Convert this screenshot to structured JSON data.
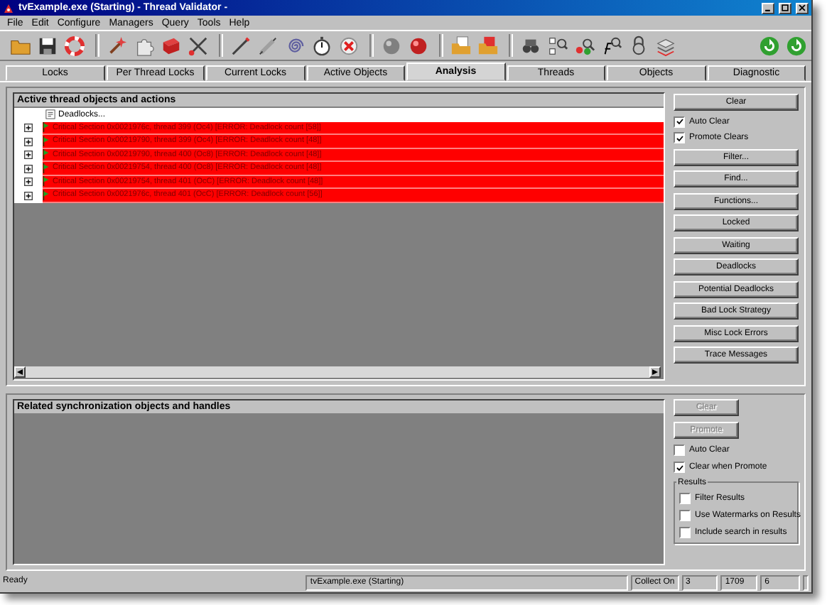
{
  "window": {
    "title": "tvExample.exe (Starting) - Thread Validator -"
  },
  "menu": [
    "File",
    "Edit",
    "Configure",
    "Managers",
    "Query",
    "Tools",
    "Help"
  ],
  "tabs": [
    {
      "label": "Locks",
      "selected": false
    },
    {
      "label": "Per Thread Locks",
      "selected": false
    },
    {
      "label": "Current Locks",
      "selected": false
    },
    {
      "label": "Active Objects",
      "selected": false
    },
    {
      "label": "Analysis",
      "selected": true
    },
    {
      "label": "Threads",
      "selected": false
    },
    {
      "label": "Objects",
      "selected": false
    },
    {
      "label": "Diagnostic",
      "selected": false
    }
  ],
  "upper_panel": {
    "title": "Active thread objects and actions",
    "tree": [
      {
        "kind": "header",
        "label": "Deadlocks..."
      },
      {
        "kind": "error",
        "expanded": false,
        "label": "Critical Section 0x0021976c, thread 399 (Oc4) [ERROR: Deadlock count [58]]"
      },
      {
        "kind": "error",
        "expanded": false,
        "label": "Critical Section 0x00219790, thread 399 (Oc4) [ERROR: Deadlock count [48]]"
      },
      {
        "kind": "error",
        "expanded": false,
        "label": "Critical Section 0x00219790, thread 400 (Oc8) [ERROR: Deadlock count [48]]"
      },
      {
        "kind": "error",
        "expanded": false,
        "label": "Critical Section 0x00219754, thread 400 (Oc8) [ERROR: Deadlock count [48]]"
      },
      {
        "kind": "error",
        "expanded": false,
        "label": "Critical Section 0x00219754, thread 401 (OcC) [ERROR: Deadlock count [48]]"
      },
      {
        "kind": "error",
        "expanded": false,
        "label": "Critical Section 0x0021976c, thread 401 (OcC) [ERROR: Deadlock count [56]]"
      }
    ],
    "controls": [
      {
        "kind": "button",
        "label": "Clear"
      },
      {
        "kind": "checkbox",
        "label": "Auto Clear",
        "checked": true
      },
      {
        "kind": "checkbox",
        "label": "Promote Clears",
        "checked": true
      },
      {
        "kind": "button",
        "label": "Filter..."
      },
      {
        "kind": "button",
        "label": "Find..."
      },
      {
        "kind": "button",
        "label": "Functions..."
      },
      {
        "kind": "button",
        "label": "Locked"
      },
      {
        "kind": "button",
        "label": "Waiting"
      },
      {
        "kind": "button",
        "label": "Deadlocks"
      },
      {
        "kind": "button",
        "label": "Potential Deadlocks"
      },
      {
        "kind": "button",
        "label": "Bad Lock Strategy"
      },
      {
        "kind": "button",
        "label": "Misc Lock Errors"
      },
      {
        "kind": "button",
        "label": "Trace Messages"
      }
    ]
  },
  "lower_panel": {
    "title": "Related synchronization objects and handles",
    "buttons": [
      {
        "label": "Clear",
        "disabled": true
      },
      {
        "label": "Promote",
        "disabled": true
      }
    ],
    "checkboxes": [
      {
        "label": "Auto Clear",
        "checked": false
      },
      {
        "label": "Clear when Promote",
        "checked": true
      }
    ],
    "results_group": {
      "title": "Results",
      "checkboxes": [
        {
          "label": "Filter Results",
          "checked": false
        },
        {
          "label": "Use Watermarks on Results",
          "checked": false
        },
        {
          "label": "Include search in results",
          "checked": false
        }
      ]
    }
  },
  "status_bar": [
    "Ready",
    "tvExample.exe (Starting)",
    "Collect On",
    "3",
    "1709",
    "6"
  ]
}
